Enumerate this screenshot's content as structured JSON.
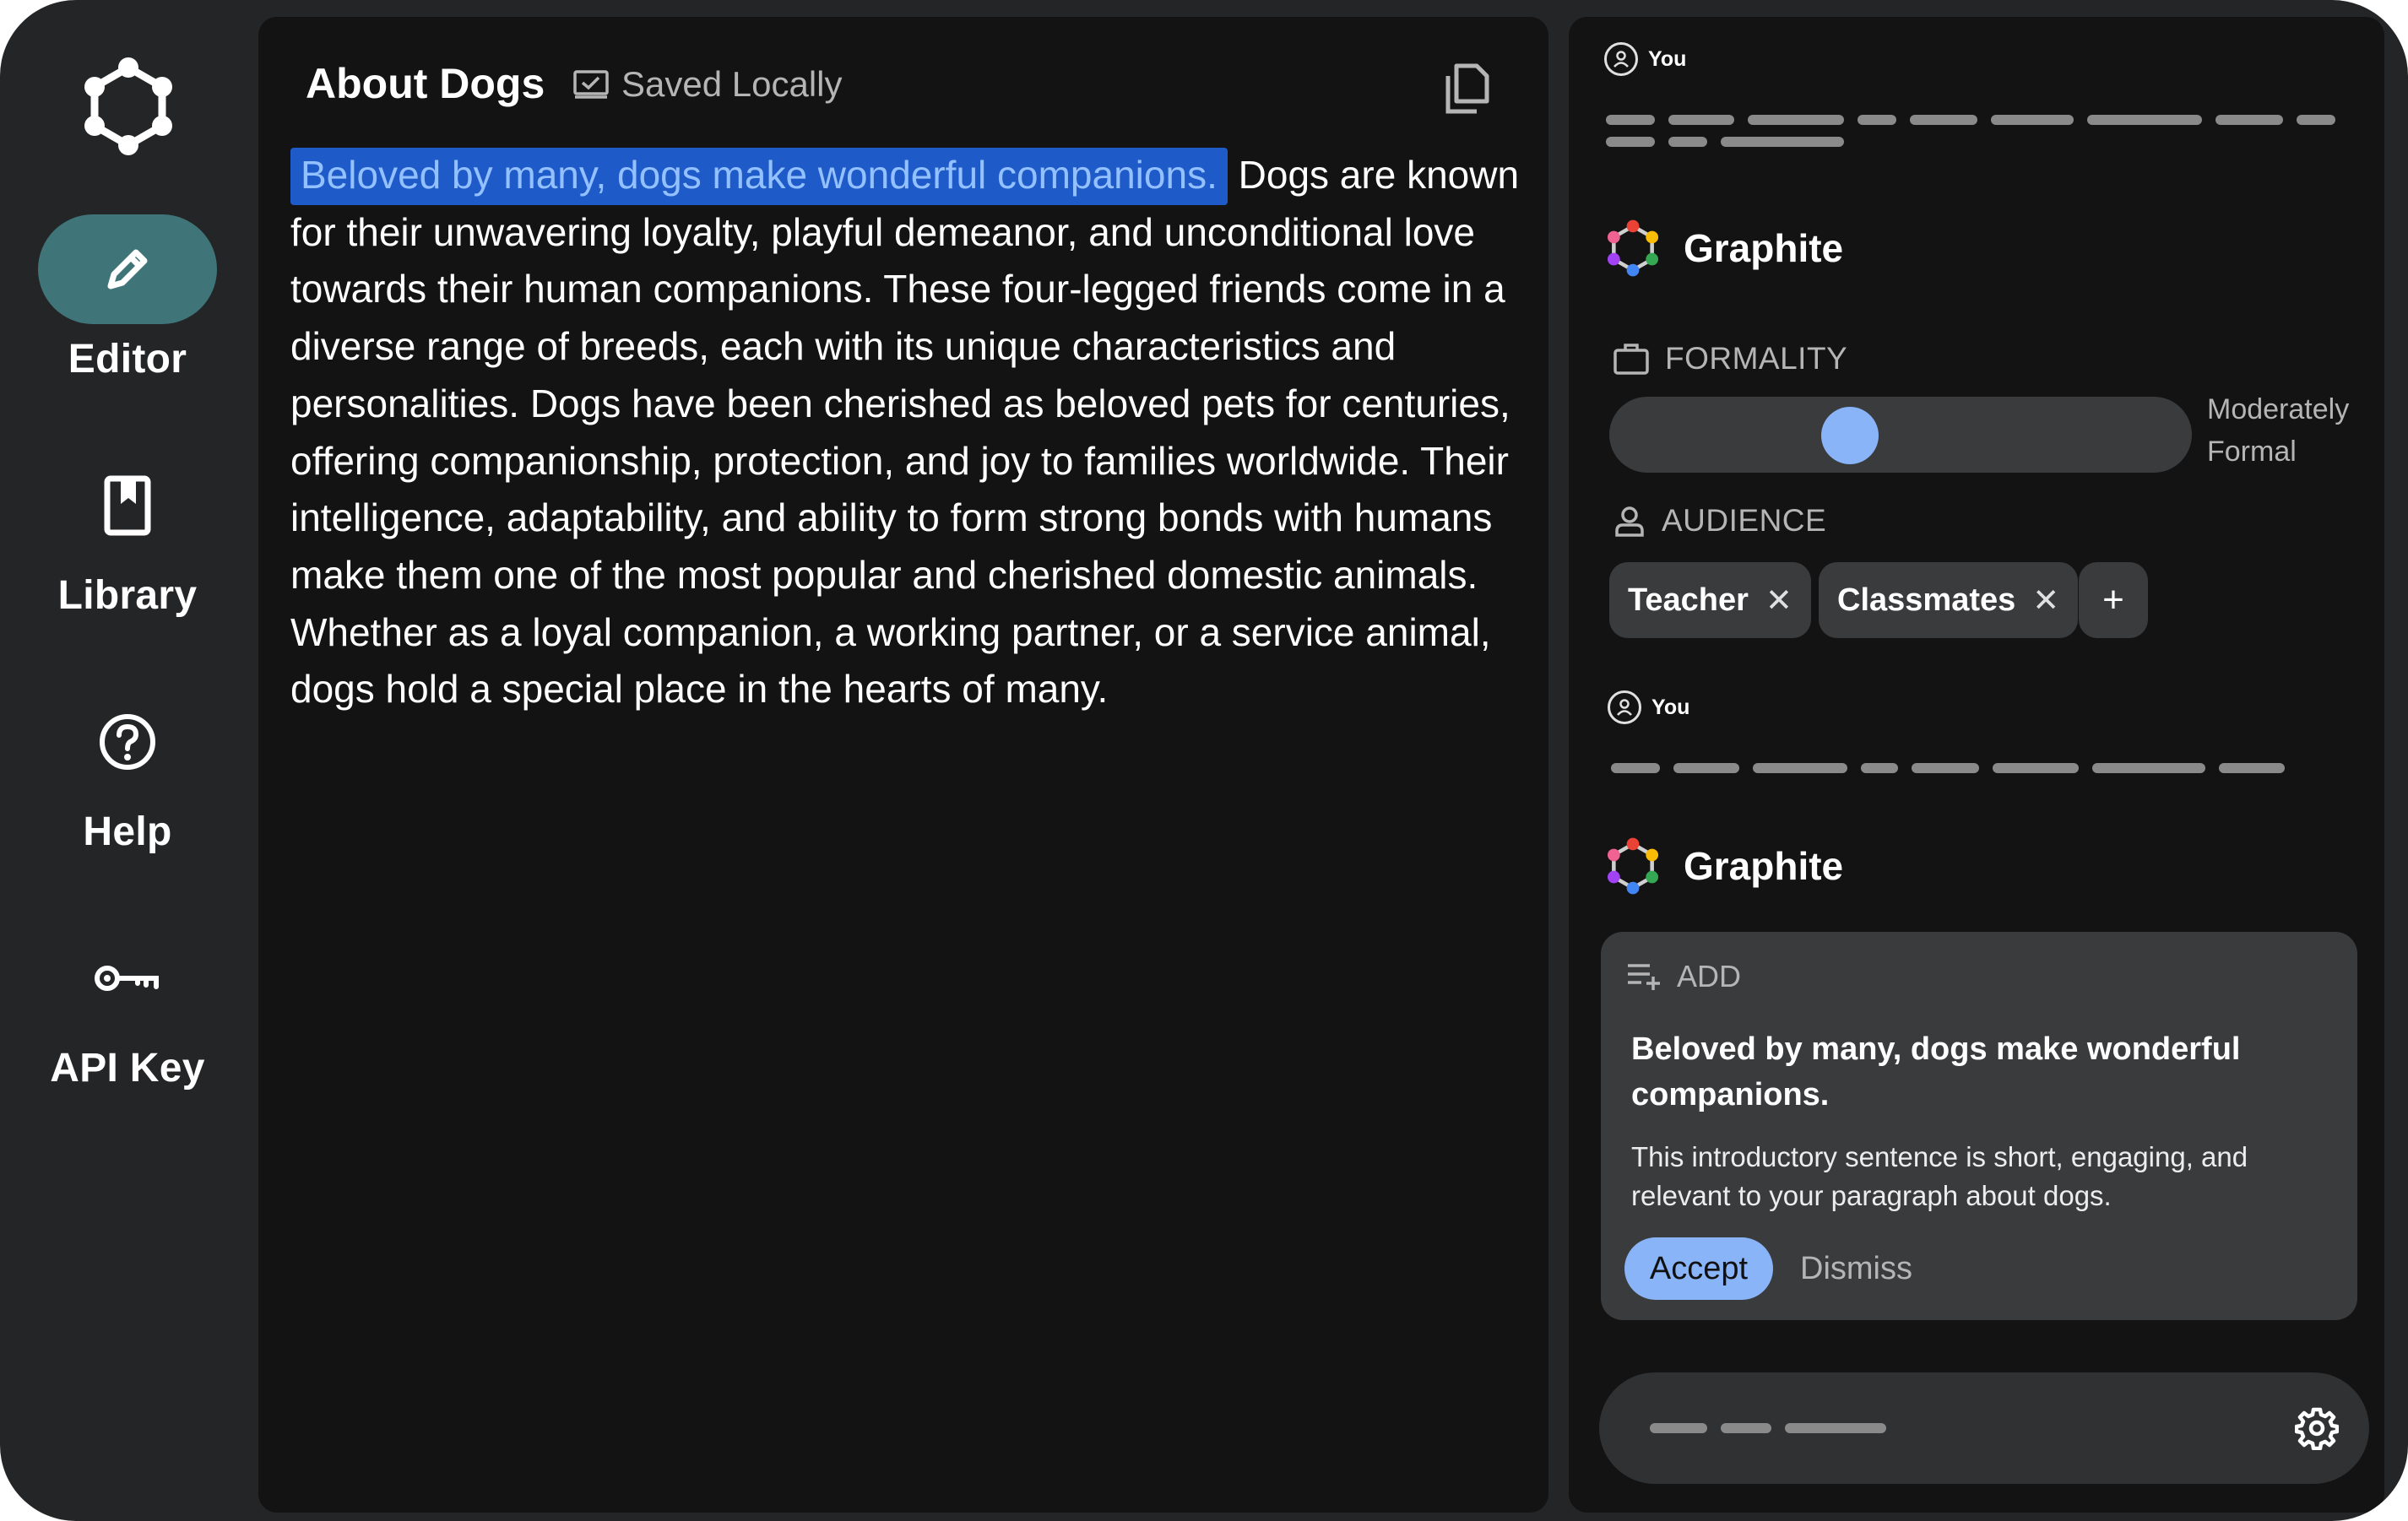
{
  "nav": {
    "items": [
      {
        "label": "Editor",
        "icon": "pencil-icon",
        "active": true
      },
      {
        "label": "Library",
        "icon": "bookmark-icon",
        "active": false
      },
      {
        "label": "Help",
        "icon": "help-circle-icon",
        "active": false
      },
      {
        "label": "API Key",
        "icon": "key-icon",
        "active": false
      }
    ]
  },
  "editor": {
    "title": "About Dogs",
    "save_status": "Saved Locally",
    "highlighted_sentence": "Beloved by many, dogs make wonderful companions.",
    "body": "Dogs are known for their unwavering loyalty, playful demeanor, and unconditional love towards their human companions. These four-legged friends come in a diverse range of breeds, each with its unique characteristics and personalities. Dogs have been cherished as beloved pets for centuries, offering companionship, protection, and joy to families worldwide. Their intelligence, adaptability, and ability to form strong bonds with humans make them one of the most popular and cherished domestic animals. Whether as a loyal companion, a working partner, or a service animal, dogs hold a special place in the hearts of many."
  },
  "assistant": {
    "user_label": "You",
    "bot_name": "Graphite",
    "formality": {
      "label": "FORMALITY",
      "value_text": "Moderately Formal",
      "level": 0.4
    },
    "audience": {
      "label": "AUDIENCE",
      "chips": [
        "Teacher",
        "Classmates"
      ],
      "add_symbol": "+",
      "remove_symbol": "✕"
    },
    "suggestion": {
      "type_label": "ADD",
      "title": "Beloved by many, dogs make wonderful companions.",
      "description": "This introductory sentence is short, engaging, and relevant to your paragraph about dogs.",
      "accept_label": "Accept",
      "dismiss_label": "Dismiss"
    }
  },
  "colors": {
    "accent_blue": "#8ab4f8",
    "active_nav": "#3f7479",
    "highlight": "#1f5bc8"
  }
}
